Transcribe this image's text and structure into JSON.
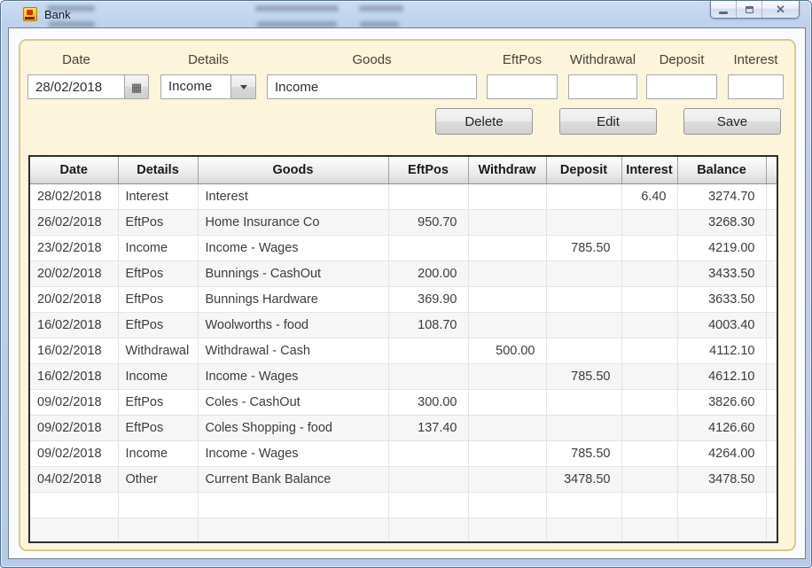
{
  "window": {
    "title": "Bank",
    "icons": {
      "calendar": "▦",
      "close": "✕"
    }
  },
  "form": {
    "fields": {
      "date": {
        "label": "Date",
        "value": "28/02/2018"
      },
      "details": {
        "label": "Details",
        "value": "Income"
      },
      "goods": {
        "label": "Goods",
        "value": "Income"
      },
      "eftpos": {
        "label": "EftPos",
        "value": ""
      },
      "withdrawal": {
        "label": "Withdrawal",
        "value": ""
      },
      "deposit": {
        "label": "Deposit",
        "value": ""
      },
      "interest": {
        "label": "Interest",
        "value": ""
      }
    },
    "buttons": {
      "delete": "Delete",
      "edit": "Edit",
      "save": "Save"
    }
  },
  "table": {
    "columns": [
      "Date",
      "Details",
      "Goods",
      "EftPos",
      "Withdraw",
      "Deposit",
      "Interest",
      "Balance"
    ],
    "rows": [
      [
        "28/02/2018",
        "Interest",
        "Interest",
        "",
        "",
        "",
        "6.40",
        "3274.70"
      ],
      [
        "26/02/2018",
        "EftPos",
        "Home Insurance Co",
        "950.70",
        "",
        "",
        "",
        "3268.30"
      ],
      [
        "23/02/2018",
        "Income",
        "Income - Wages",
        "",
        "",
        "785.50",
        "",
        "4219.00"
      ],
      [
        "20/02/2018",
        "EftPos",
        "Bunnings - CashOut",
        "200.00",
        "",
        "",
        "",
        "3433.50"
      ],
      [
        "20/02/2018",
        "EftPos",
        "Bunnings Hardware",
        "369.90",
        "",
        "",
        "",
        "3633.50"
      ],
      [
        "16/02/2018",
        "EftPos",
        "Woolworths - food",
        "108.70",
        "",
        "",
        "",
        "4003.40"
      ],
      [
        "16/02/2018",
        "Withdrawal",
        "Withdrawal - Cash",
        "",
        "500.00",
        "",
        "",
        "4112.10"
      ],
      [
        "16/02/2018",
        "Income",
        "Income - Wages",
        "",
        "",
        "785.50",
        "",
        "4612.10"
      ],
      [
        "09/02/2018",
        "EftPos",
        "Coles - CashOut",
        "300.00",
        "",
        "",
        "",
        "3826.60"
      ],
      [
        "09/02/2018",
        "EftPos",
        "Coles Shopping - food",
        "137.40",
        "",
        "",
        "",
        "4126.60"
      ],
      [
        "09/02/2018",
        "Income",
        "Income - Wages",
        "",
        "",
        "785.50",
        "",
        "4264.00"
      ],
      [
        "04/02/2018",
        "Other",
        "Current Bank Balance",
        "",
        "",
        "3478.50",
        "",
        "3478.50"
      ]
    ],
    "empty_rows": 2
  },
  "colors": {
    "panel_bg": "#fcf5dc",
    "panel_border": "#ddc78f",
    "titlebar_bg": "#bdd1ec",
    "grid_border": "#2f2f2f",
    "row_alt": "#f6f6f6",
    "app_icon_gold": "#f2b500",
    "app_icon_red": "#d23000"
  }
}
